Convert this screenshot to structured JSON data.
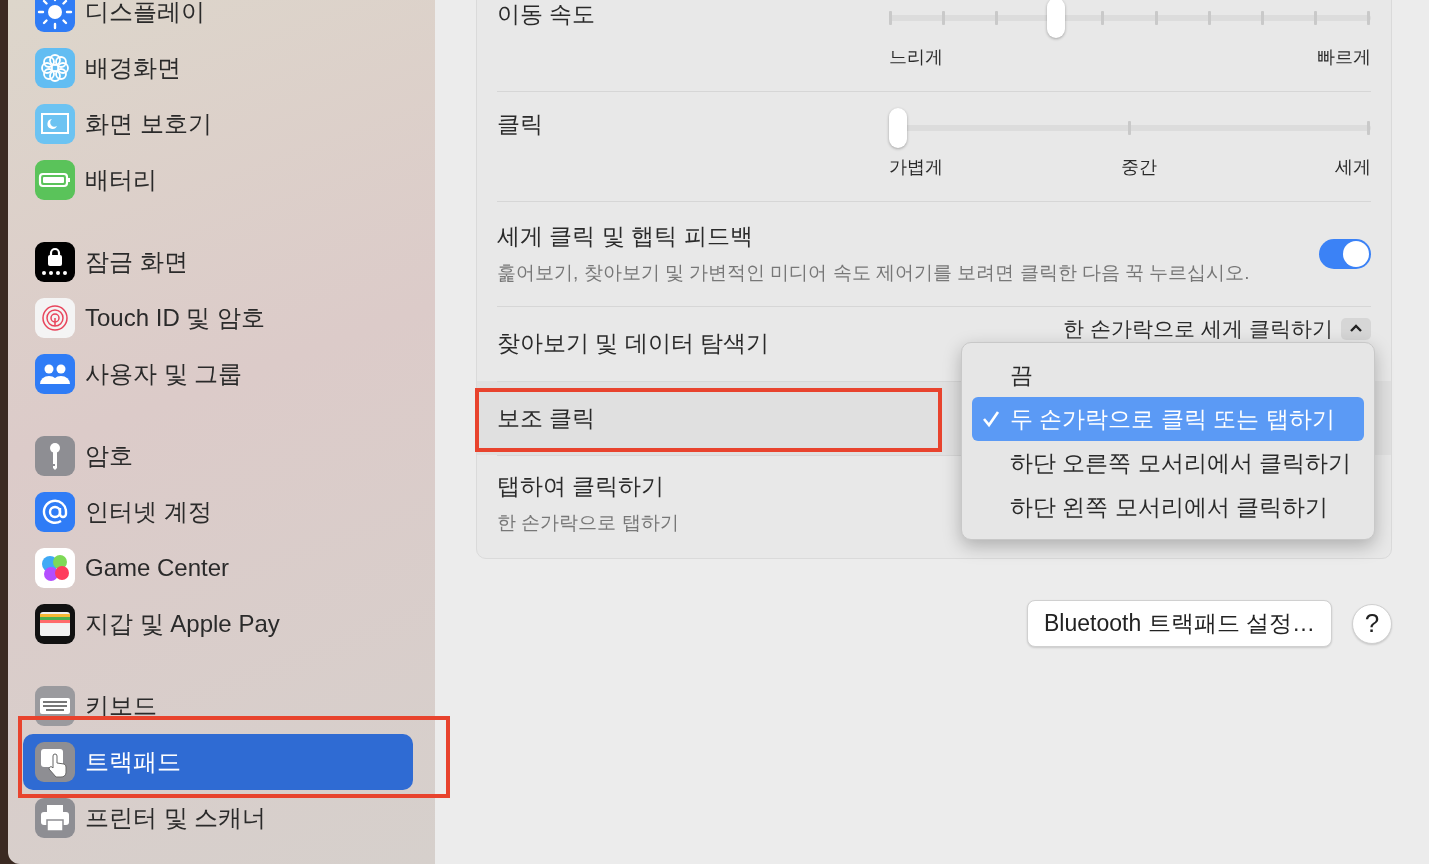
{
  "sidebar": {
    "groups": [
      {
        "items": [
          {
            "label": "디스플레이",
            "selected": false,
            "highlighted": false
          },
          {
            "label": "배경화면",
            "selected": false,
            "highlighted": false
          },
          {
            "label": "화면 보호기",
            "selected": false,
            "highlighted": false
          },
          {
            "label": "배터리",
            "selected": false,
            "highlighted": false
          }
        ]
      },
      {
        "items": [
          {
            "label": "잠금 화면",
            "selected": false,
            "highlighted": false
          },
          {
            "label": "Touch ID 및 암호",
            "selected": false,
            "highlighted": false
          },
          {
            "label": "사용자 및 그룹",
            "selected": false,
            "highlighted": false
          }
        ]
      },
      {
        "items": [
          {
            "label": "암호",
            "selected": false,
            "highlighted": false
          },
          {
            "label": "인터넷 계정",
            "selected": false,
            "highlighted": false
          },
          {
            "label": "Game Center",
            "selected": false,
            "highlighted": false
          },
          {
            "label": "지갑 및 Apple Pay",
            "selected": false,
            "highlighted": false
          }
        ]
      },
      {
        "items": [
          {
            "label": "키보드",
            "selected": false,
            "highlighted": false
          },
          {
            "label": "트랙패드",
            "selected": true,
            "highlighted": true
          },
          {
            "label": "프린터 및 스캐너",
            "selected": false,
            "highlighted": false
          }
        ]
      }
    ]
  },
  "settings": {
    "rows": [
      {
        "kind": "slider",
        "label": "이동 속도",
        "level": 0.34,
        "tick_labels": [
          "느리게",
          "빠르게"
        ],
        "highlighted": false
      },
      {
        "kind": "slider",
        "label": "클릭",
        "level": 0,
        "tick_labels": [
          "가볍게",
          "중간",
          "세게"
        ],
        "highlighted": false
      },
      {
        "kind": "toggle",
        "label": "세게 클릭 및 햅틱 피드백",
        "description": "훑어보기, 찾아보기 및 가변적인 미디어 속도 제어기를 보려면 클릭한 다음 꾹 누르십시오.",
        "on": true,
        "highlighted": false
      },
      {
        "kind": "popup",
        "label": "찾아보기 및 데이터 탐색기",
        "value": "한 손가락으로 세게 클릭하기",
        "highlighted": false
      },
      {
        "kind": "menu",
        "label": "보조 클릭",
        "highlighted": true,
        "options": [
          {
            "label": "끔",
            "selected": false
          },
          {
            "label": "두 손가락으로 클릭 또는 탭하기",
            "selected": true
          },
          {
            "label": "하단 오른쪽 모서리에서 클릭하기",
            "selected": false
          },
          {
            "label": "하단 왼쪽 모서리에서 클릭하기",
            "selected": false
          }
        ]
      },
      {
        "kind": "plain",
        "label": "탭하여 클릭하기",
        "description": "한 손가락으로 탭하기",
        "highlighted": false
      }
    ]
  },
  "buttons": {
    "bluetooth": "Bluetooth 트랙패드 설정…",
    "help": "?"
  }
}
